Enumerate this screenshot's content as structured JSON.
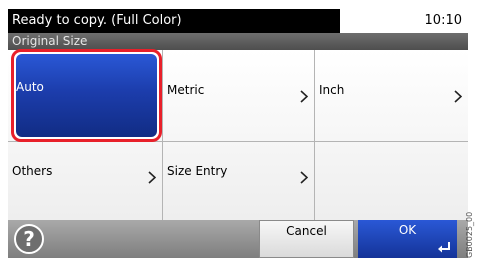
{
  "status": {
    "message": "Ready to copy. (Full Color)",
    "time": "10:10"
  },
  "screen": {
    "title": "Original Size"
  },
  "options": {
    "auto": "Auto",
    "metric": "Metric",
    "inch": "Inch",
    "others": "Others",
    "size_entry": "Size Entry"
  },
  "footer": {
    "help_label": "?",
    "cancel_label": "Cancel",
    "ok_label": "OK"
  },
  "figure_id": "GB0025_00",
  "colors": {
    "accent_blue": "#1c3dac",
    "highlight_red": "#e8202a"
  }
}
